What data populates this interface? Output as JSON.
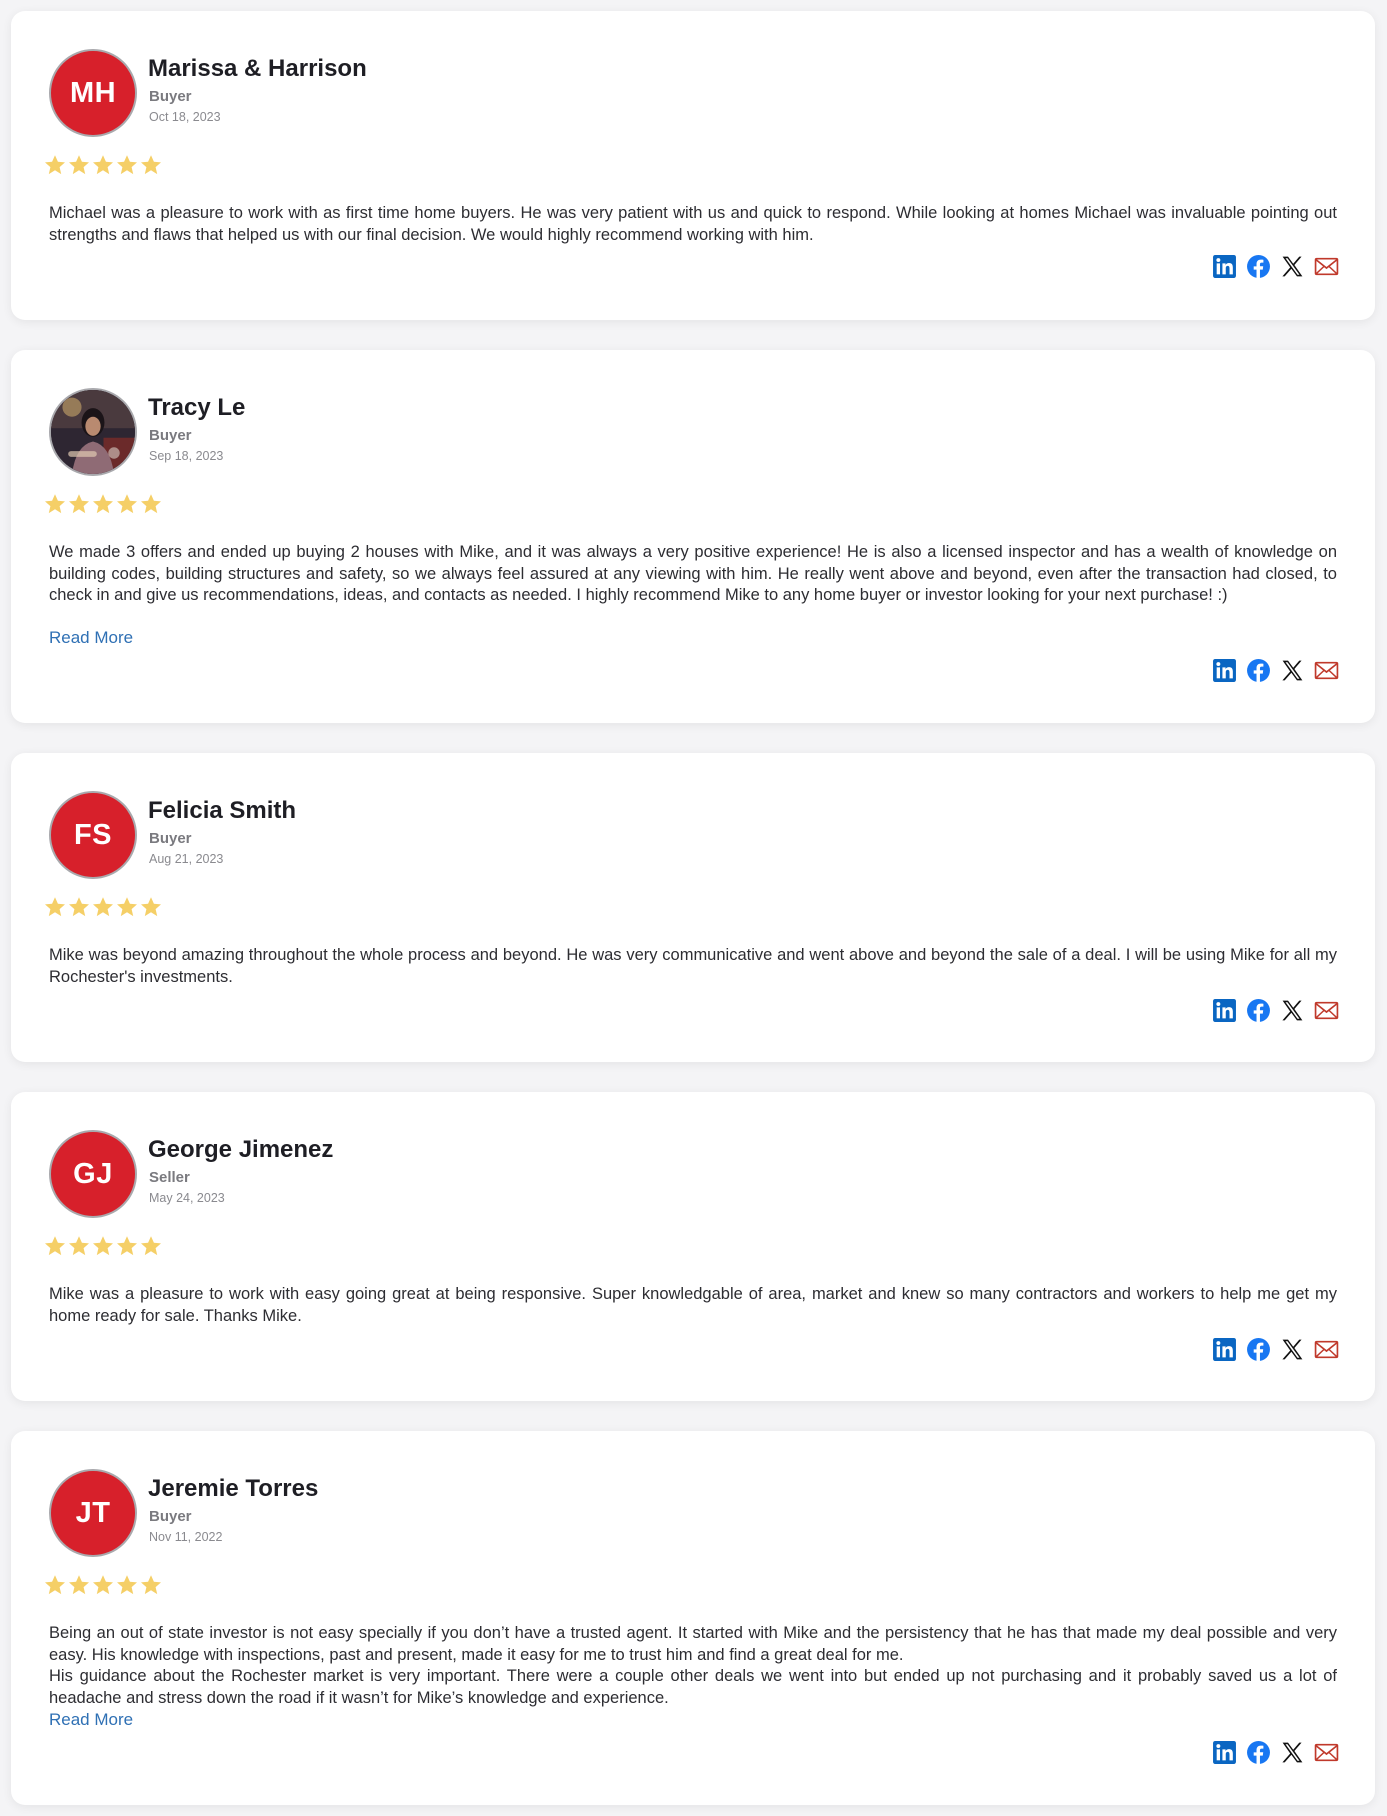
{
  "reviews": [
    {
      "initials": "MH",
      "name": "Marissa & Harrison",
      "role": "Buyer",
      "date": "Oct 18, 2023",
      "rating": 5,
      "paragraphs": [
        "Michael was a pleasure to work with as first time home buyers. He was very patient with us and quick to respond. While looking at homes Michael was invaluable pointing out strengths and flaws that helped us with our final decision. We would highly recommend working with him."
      ],
      "read_more": ""
    },
    {
      "initials": "",
      "avatar": "photo-avatar",
      "name": "Tracy Le",
      "role": "Buyer",
      "date": "Sep 18, 2023",
      "rating": 5,
      "paragraphs": [
        "We made 3 offers and ended up buying 2 houses with Mike, and it was always a very positive experience! He is also a licensed inspector and has a wealth of knowledge on building codes, building structures and safety, so we always feel assured at any viewing with him. He really went above and beyond, even after the transaction had closed, to check in and give us recommendations, ideas, and contacts as needed. I highly recommend Mike to any home buyer or investor looking for your next purchase! :)"
      ],
      "read_more": "Read More"
    },
    {
      "initials": "FS",
      "name": "Felicia Smith",
      "role": "Buyer",
      "date": "Aug 21, 2023",
      "rating": 5,
      "paragraphs": [
        "Mike was beyond amazing throughout the whole process and beyond. He was very communicative and went above and beyond the sale of a deal. I will be using Mike for all my Rochester's investments."
      ],
      "read_more": ""
    },
    {
      "initials": "GJ",
      "name": "George Jimenez",
      "role": "Seller",
      "date": "May 24, 2023",
      "rating": 5,
      "paragraphs": [
        "Mike was a pleasure to work with easy going great at being responsive. Super knowledgable of area, market and knew so many contractors and workers to help me get my home ready for sale. Thanks Mike."
      ],
      "read_more": ""
    },
    {
      "initials": "JT",
      "name": "Jeremie Torres",
      "role": "Buyer",
      "date": "Nov 11, 2022",
      "rating": 5,
      "paragraphs": [
        "Being an out of state investor is not easy specially if you don’t have a trusted agent. It started with Mike and the persistency that he has that made my deal possible and very easy. His knowledge with inspections, past and present, made it easy for me to trust him and find a great deal for me.",
        "His guidance about the Rochester market is very important. There were a couple other deals we went into but ended up not purchasing and it probably saved us a lot of headache and stress down the road if it wasn’t for Mike’s knowledge and experience."
      ],
      "read_more": "Read More"
    }
  ],
  "share_icons": [
    "linkedin-icon",
    "facebook-icon",
    "x-icon",
    "email-icon"
  ],
  "colors": {
    "avatar_bg": "#d7202b",
    "star": "#f5cf67",
    "link": "#2f70b4",
    "linkedin": "#0a66c2",
    "facebook": "#1877f2",
    "email": "#c0392b"
  }
}
